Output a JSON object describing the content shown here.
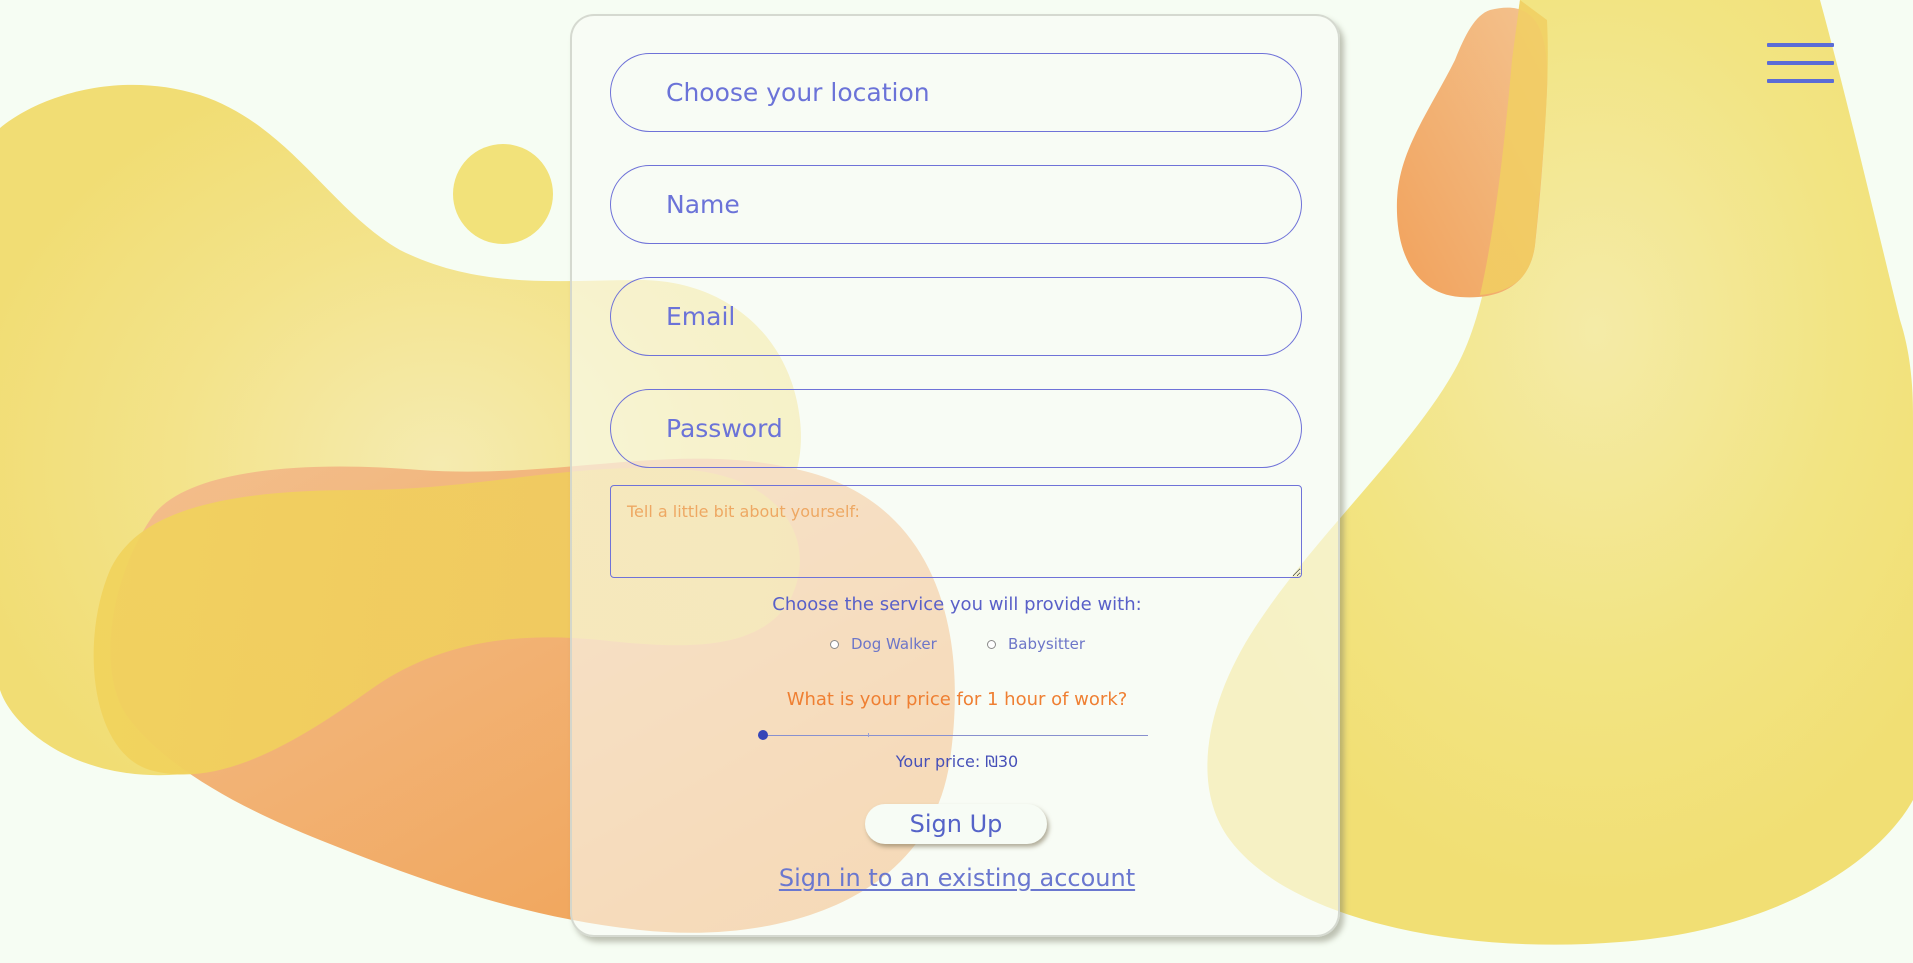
{
  "form": {
    "location_placeholder": "Choose your location",
    "name_placeholder": "Name",
    "email_placeholder": "Email",
    "password_placeholder": "Password",
    "about_placeholder": "Tell a little bit about yourself:",
    "service_title": "Choose the service you will provide with:",
    "services": [
      {
        "label": "Dog Walker",
        "selected": false
      },
      {
        "label": "Babysitter",
        "selected": false
      }
    ],
    "price_question": "What is your price for 1 hour of work?",
    "price_slider_fraction": 0.0,
    "price_label": "Your price: ₪30",
    "signup_label": "Sign Up",
    "signin_link": "Sign in to an existing account"
  },
  "colors": {
    "background": "#f6fdf3",
    "accent": "#6b73d8",
    "orange": "#ef7f32",
    "yellow_blob": "#f2e27a",
    "orange_blob": "#f0a45a"
  },
  "icons": {
    "menu": "hamburger-menu-icon"
  }
}
